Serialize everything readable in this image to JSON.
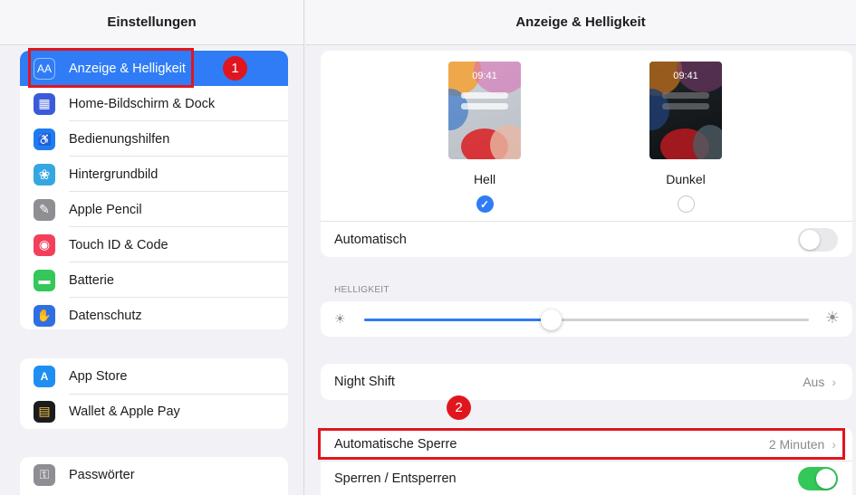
{
  "sidebar": {
    "title": "Einstellungen",
    "groups": [
      {
        "items": [
          {
            "label": "Anzeige & Helligkeit",
            "icon": "display-brightness-icon",
            "icon_glyph": "AA",
            "icon_color": "#2f7cf6",
            "selected": true
          },
          {
            "label": "Home-Bildschirm & Dock",
            "icon": "home-screen-grid-icon",
            "icon_glyph": "▦",
            "icon_color": "#3a5bd9"
          },
          {
            "label": "Bedienungshilfen",
            "icon": "accessibility-icon",
            "icon_glyph": "♿",
            "icon_color": "#1e7cf2"
          },
          {
            "label": "Hintergrundbild",
            "icon": "wallpaper-flower-icon",
            "icon_glyph": "❀",
            "icon_color": "#35a7e0"
          },
          {
            "label": "Apple Pencil",
            "icon": "pencil-icon",
            "icon_glyph": "✎",
            "icon_color": "#8e8e93"
          },
          {
            "label": "Touch ID & Code",
            "icon": "fingerprint-icon",
            "icon_glyph": "◉",
            "icon_color": "#f2405c"
          },
          {
            "label": "Batterie",
            "icon": "battery-icon",
            "icon_glyph": "▬",
            "icon_color": "#34c759"
          },
          {
            "label": "Datenschutz",
            "icon": "privacy-hand-icon",
            "icon_glyph": "✋",
            "icon_color": "#2f6fe4"
          }
        ]
      },
      {
        "items": [
          {
            "label": "App Store",
            "icon": "app-store-icon",
            "icon_glyph": "A",
            "icon_color": "#1f8ef1"
          },
          {
            "label": "Wallet & Apple Pay",
            "icon": "wallet-icon",
            "icon_glyph": "▤",
            "icon_color": "#1c1c1e"
          }
        ]
      },
      {
        "items": [
          {
            "label": "Passwörter",
            "icon": "key-icon",
            "icon_glyph": "⚿",
            "icon_color": "#8e8e93"
          }
        ]
      }
    ]
  },
  "detail": {
    "title": "Anzeige & Helligkeit",
    "appearance": {
      "light": {
        "label": "Hell",
        "time": "09:41",
        "selected": true
      },
      "dark": {
        "label": "Dunkel",
        "time": "09:41",
        "selected": false
      },
      "automatic_label": "Automatisch",
      "automatic_on": false
    },
    "brightness": {
      "section_label": "HELLIGKEIT",
      "level": 0.42
    },
    "night_shift": {
      "label": "Night Shift",
      "value": "Aus"
    },
    "auto_lock": {
      "label": "Automatische Sperre",
      "value": "2 Minuten"
    },
    "lock_unlock": {
      "label": "Sperren / Entsperren",
      "on": true
    }
  },
  "annotations": {
    "badge_1": "1",
    "badge_2": "2",
    "color": "#e0161f"
  }
}
